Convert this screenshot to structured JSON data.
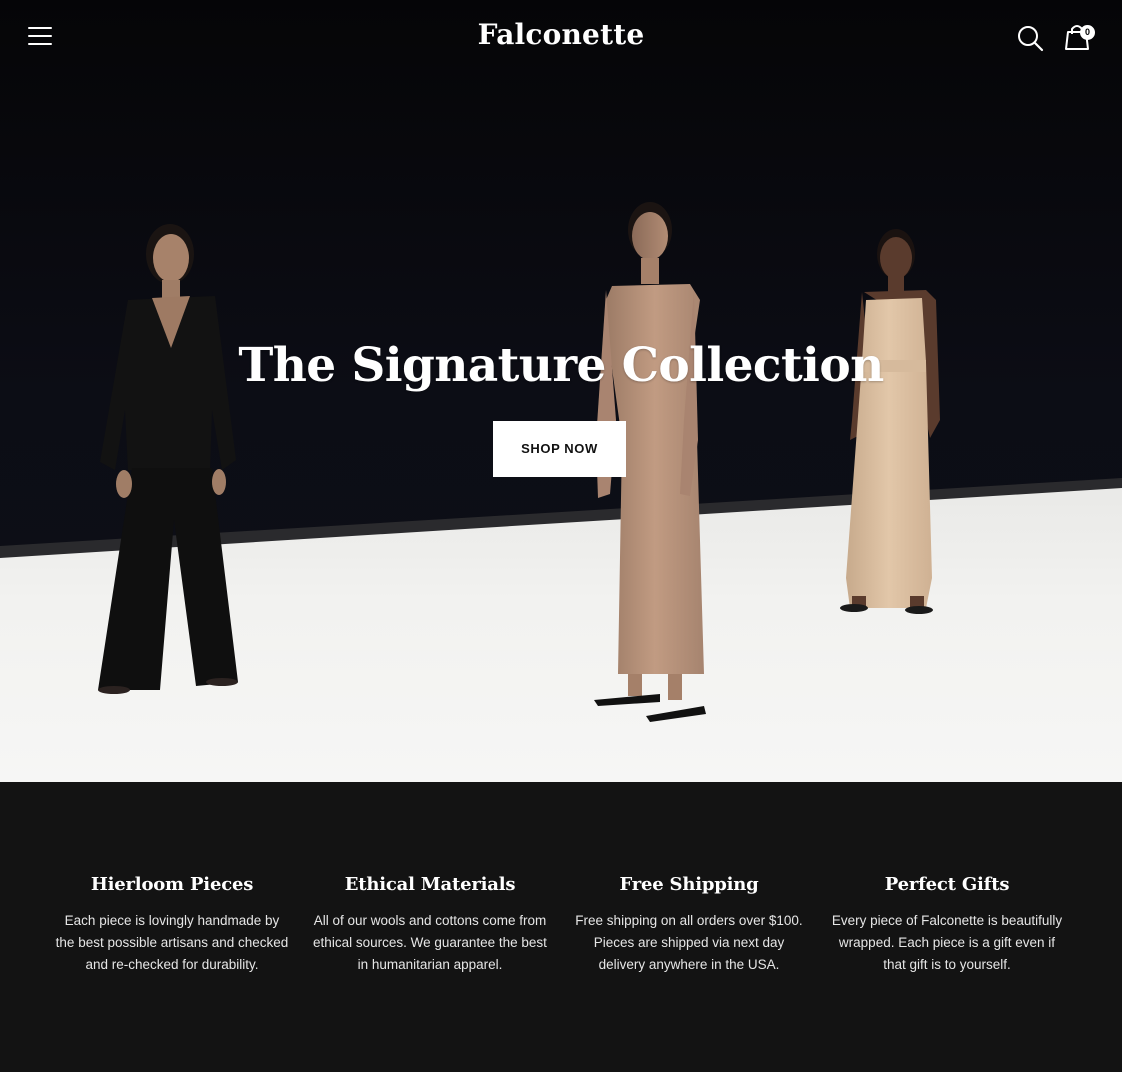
{
  "header": {
    "logo": "Falconette",
    "cart_count": "0",
    "icons": {
      "menu": "hamburger-icon",
      "search": "search-icon",
      "cart": "shopping-bag-icon"
    }
  },
  "hero": {
    "title": "The Signature Collection",
    "cta_label": "SHOP NOW"
  },
  "features": [
    {
      "title": "Hierloom Pieces",
      "lines": [
        "Each piece is lovingly handmade by",
        "the best possible artisans and checked",
        "and re-checked for durability."
      ]
    },
    {
      "title": "Ethical Materials",
      "lines": [
        "All of our wools and cottons come from",
        "ethical sources. We guarantee the best",
        "in humanitarian apparel."
      ]
    },
    {
      "title": "Free Shipping",
      "lines": [
        "Free shipping on all orders over $100.",
        "Pieces are shipped via next day",
        "delivery anywhere in the USA."
      ]
    },
    {
      "title": "Perfect Gifts",
      "lines": [
        "Every piece of Falconette is beautifully",
        "wrapped. Each piece is a gift even if",
        "that gift is to yourself."
      ]
    }
  ],
  "colors": {
    "background": "#131313",
    "backdrop": "#0b0c13",
    "floor": "#f2f2f0",
    "button_bg": "#ffffff"
  }
}
